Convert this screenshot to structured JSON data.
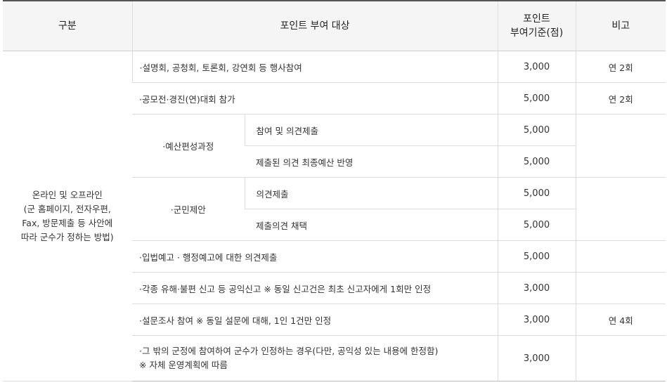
{
  "header": {
    "col1": "구분",
    "col2": "포인트 부여 대상",
    "col3_line1": "포인트",
    "col3_line2": "부여기준(점)",
    "col4": "비고"
  },
  "category": {
    "line1": "온라인 및 오프라인",
    "line2": "(군 홈페이지, 전자우편,",
    "line3": "Fax, 방문제출 등 사안에",
    "line4": "따라 군수가 정하는 방법)"
  },
  "rows": [
    {
      "target": "·설명회, 공청회, 토론회, 강연회 등 행사참여",
      "points": "3,000",
      "note": "연 2회"
    },
    {
      "target": "·공모전·경진(연)대회 참가",
      "points": "5,000",
      "note": "연 2회"
    },
    {
      "group": "·예산편성과정",
      "target": "참여 및 의견제출",
      "points": "5,000"
    },
    {
      "target": "제출된 의견 최종예산 반영",
      "points": "5,000"
    },
    {
      "group": "·군민제안",
      "target": "의견제출",
      "points": "5,000"
    },
    {
      "target": "제출의견 채택",
      "points": "5,000"
    },
    {
      "target": "·입법예고 · 행정예고에 대한 의견제출",
      "points": "5,000"
    },
    {
      "target": "·각종 유해·불편 신고 등 공익신고 ※ 동일 신고건은 최초 신고자에게 1회만 인정",
      "points": "3,000"
    },
    {
      "target": "·설문조사 참여 ※ 동일 설문에 대해, 1인 1건만 인정",
      "points": "3,000",
      "note": "연 4회"
    },
    {
      "target_line1": "·그 밖의 군정에 참여하여 군수가 인정하는 경우(다만, 공익성 있는 내용에 한정함)",
      "target_line2": "※ 자체 운영계획에 따름",
      "points": "3,000"
    }
  ]
}
